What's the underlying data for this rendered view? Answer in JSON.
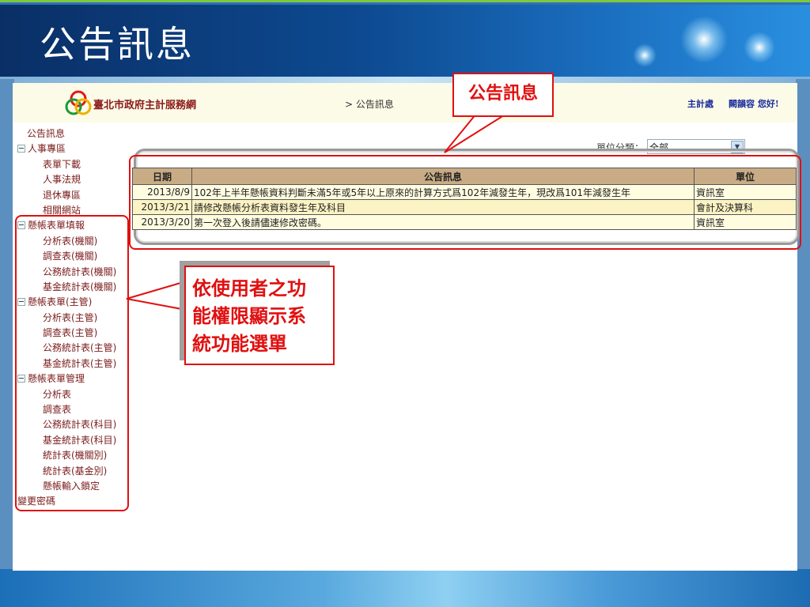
{
  "slide": {
    "title": "公告訊息"
  },
  "header": {
    "site_name": "臺北市政府主計服務網",
    "breadcrumb": "> 公告訊息",
    "user_unit": "主計處",
    "user_greeting": "闕韻容 您好!"
  },
  "nav": {
    "items": [
      {
        "label": "公告訊息",
        "level": 0
      },
      {
        "label": "人事專區",
        "level": "group"
      },
      {
        "label": "表單下載",
        "level": 1
      },
      {
        "label": "人事法規",
        "level": 1
      },
      {
        "label": "退休專區",
        "level": 1
      },
      {
        "label": "相關網站",
        "level": 1
      },
      {
        "label": "懸帳表單填報",
        "level": "group"
      },
      {
        "label": "分析表(機關)",
        "level": 1
      },
      {
        "label": "調查表(機關)",
        "level": 1
      },
      {
        "label": "公務統計表(機關)",
        "level": 1
      },
      {
        "label": "基金統計表(機關)",
        "level": 1
      },
      {
        "label": "懸帳表單(主管)",
        "level": "group"
      },
      {
        "label": "分析表(主管)",
        "level": 1
      },
      {
        "label": "調查表(主管)",
        "level": 1
      },
      {
        "label": "公務統計表(主管)",
        "level": 1
      },
      {
        "label": "基金統計表(主管)",
        "level": 1
      },
      {
        "label": "懸帳表單管理",
        "level": "group"
      },
      {
        "label": "分析表",
        "level": 1
      },
      {
        "label": "調查表",
        "level": 1
      },
      {
        "label": "公務統計表(科目)",
        "level": 1
      },
      {
        "label": "基金統計表(科目)",
        "level": 1
      },
      {
        "label": "統計表(機關別)",
        "level": 1
      },
      {
        "label": "統計表(基金別)",
        "level": 1
      },
      {
        "label": "懸帳輸入鎖定",
        "level": 1
      },
      {
        "label": "變更密碼",
        "level": 0
      }
    ]
  },
  "filter": {
    "label": "單位分類：",
    "value": "全部"
  },
  "table": {
    "headers": [
      "日期",
      "公告訊息",
      "單位"
    ],
    "rows": [
      {
        "date": "2013/8/9",
        "message": "102年上半年懸帳資料判斷未滿5年或5年以上原來的計算方式爲102年減發生年，現改爲101年減發生年",
        "unit": "資訊室"
      },
      {
        "date": "2013/3/21",
        "message": "請修改懸帳分析表資料發生年及科目",
        "unit": "會計及決算科"
      },
      {
        "date": "2013/3/20",
        "message": "第一次登入後請儘速修改密碼。",
        "unit": "資訊室"
      }
    ]
  },
  "callouts": {
    "top": "公告訊息",
    "left": [
      "依使用者之功",
      "能權限顯示系",
      "統功能選單"
    ]
  },
  "colors": {
    "annotation": "#e01010",
    "header_bg": "#fbfbe8",
    "table_header": "#c9ac86"
  }
}
